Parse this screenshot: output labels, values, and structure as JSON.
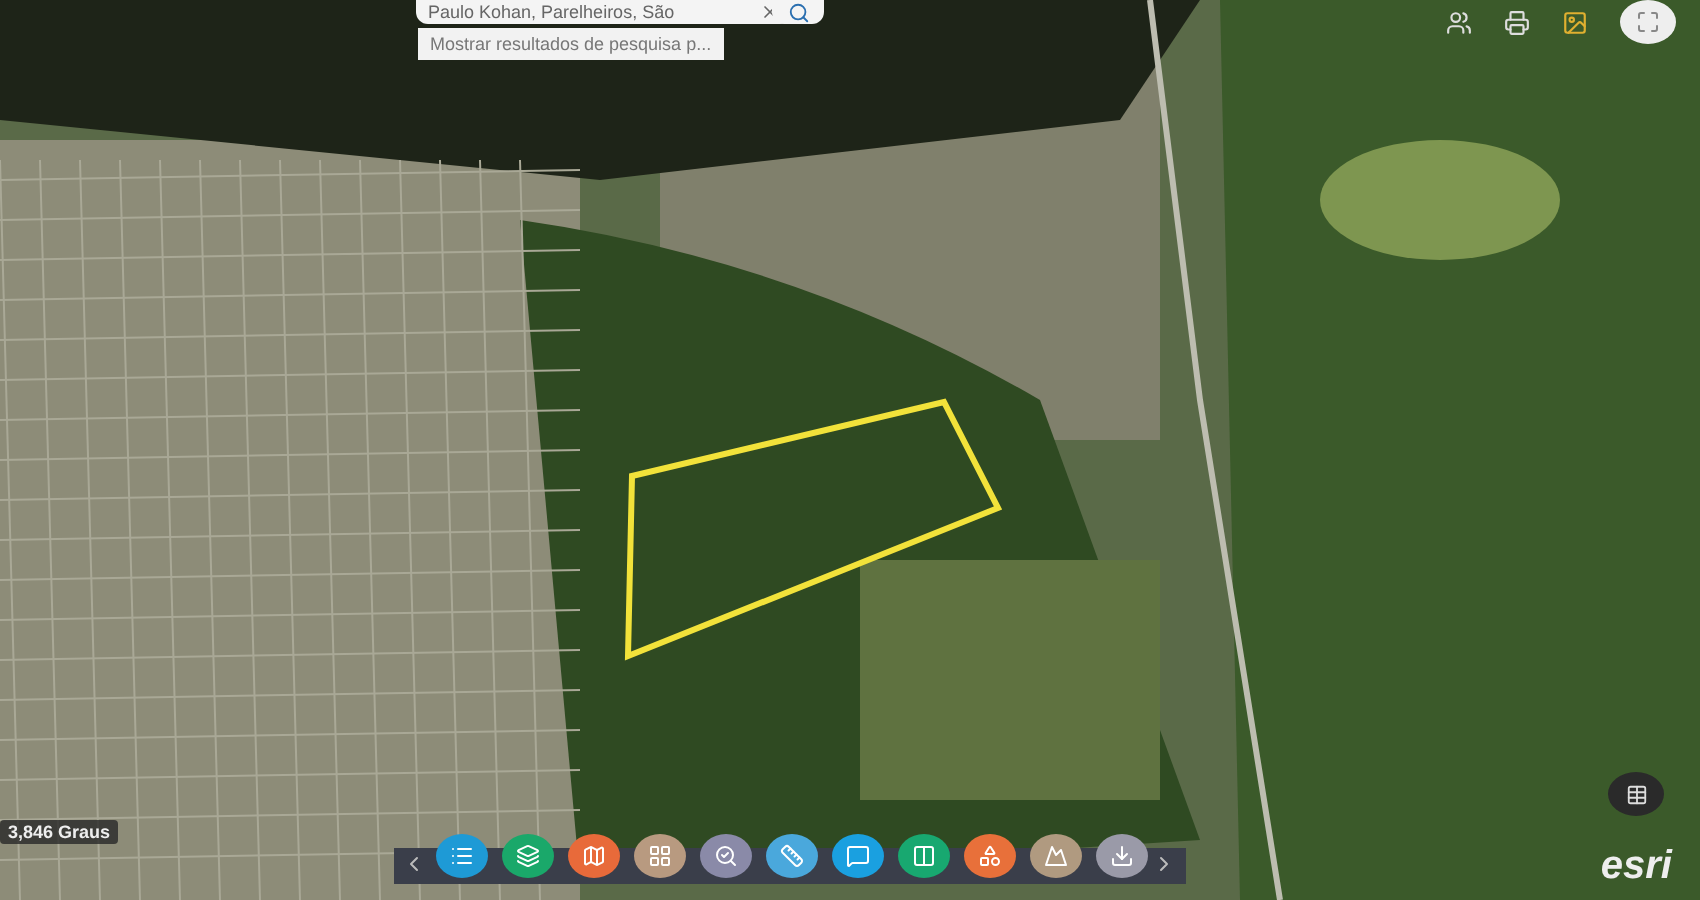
{
  "search": {
    "value": "Paulo Kohan, Parelheiros, São",
    "suggestion": "Mostrar resultados de pesquisa p..."
  },
  "map": {
    "coordinate_label": "3,846 Graus",
    "attribution": "esri"
  },
  "toolbar": {
    "tools": [
      {
        "color": "#1e9ad6"
      },
      {
        "color": "#1aa86a"
      },
      {
        "color": "#e86a3a"
      },
      {
        "color": "#b89a80"
      },
      {
        "color": "#8a8aa8"
      },
      {
        "color": "#4aa8dc"
      },
      {
        "color": "#1aa0e0"
      },
      {
        "color": "#18a870"
      },
      {
        "color": "#e8703a"
      },
      {
        "color": "#b09a80"
      },
      {
        "color": "#9a9aa8"
      }
    ]
  }
}
